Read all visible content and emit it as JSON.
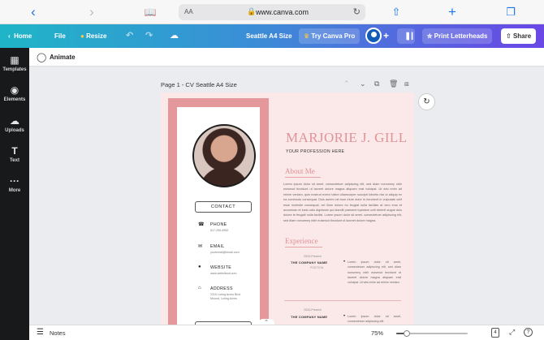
{
  "safari": {
    "back_icon": "chevron-left-icon",
    "forward_icon": "chevron-right-icon",
    "text_size_label": "AA",
    "url": "www.canva.com"
  },
  "topbar": {
    "home_label": "Home",
    "file_label": "File",
    "resize_label": "Resize",
    "doc_title": "Seattle A4 Size",
    "try_pro_label": "Try Canva Pro",
    "print_label": "Print Letterheads",
    "share_label": "Share",
    "colors": {
      "accent_start": "#1fb5c7",
      "accent_end": "#6a47e6"
    }
  },
  "sidebar": {
    "items": [
      {
        "label": "Templates",
        "icon": "templates-icon"
      },
      {
        "label": "Elements",
        "icon": "elements-icon"
      },
      {
        "label": "Uploads",
        "icon": "upload-cloud-icon"
      },
      {
        "label": "Text",
        "icon": "text-icon"
      },
      {
        "label": "More",
        "icon": "more-dots-icon"
      }
    ]
  },
  "toolbar": {
    "animate_label": "Animate"
  },
  "page": {
    "label": "Page 1 - CV Seattle A4 Size"
  },
  "resume": {
    "name": "MARJORIE J. GILL",
    "profession": "YOUR PROFESSION HERE",
    "contact_heading": "CONTACT",
    "phone_title": "PHONE",
    "phone_value": "617-290-4952",
    "email_title": "EMAIL",
    "email_value": "youremail@email.com",
    "website_title": "WEBSITE",
    "website_value": "www.websiteurl.com",
    "address_title": "ADDRESS",
    "address_value": "2310 Loring Acres Blvd Mound, Loring Acres",
    "social_heading": "SOCIAL MEDIA",
    "about_heading": "About Me",
    "about_text": "Lorem ipsum dolor sit amet, consectetuer adipiscing elit, sed diam nonummy nibh euismod tincidunt ut laoreet dolore magna aliquam erat volutpat. Ut wisi enim ad minim veniam, quis nostrud exerci tation ullamcorper suscipit lobortis nisl ut aliquip ex ea commodo consequat. Duis autem vel eum iriure dolor in hendrerit in vulputate velit esse molestie consequat, vel illum dolore eu feugiat nulla facilisis at vero eros et accumsan et iusto odio dignissim qui blandit praesent luptatum zzril delenit augue duis dolore te feugait nulla facilisi. Lorem ipsum dolor sit amet, consectetuer adipiscing elit, sed diam nonummy nibh euismod tincidunt ut laoreet dolore magna.",
    "experience_heading": "Experience",
    "experience": [
      {
        "date": "2020-Present",
        "company": "THE COMPANY NAME",
        "position": "POSITION",
        "text": "Lorem ipsum dolor sit amet, consectetuer adipiscing elit, sed diam nonummy nibh euismod tincidunt ut laoreet dolore magna aliquam erat volutpat. Ut wisi enim ad minim veniam."
      },
      {
        "date": "2020-Present",
        "company": "THE COMPANY NAME",
        "position": "POSITION",
        "text": "Lorem ipsum dolor sit amet, consectetuer adipiscing elit."
      }
    ]
  },
  "bottom": {
    "notes_label": "Notes",
    "zoom_label": "75%",
    "zoom_fraction": 0.15,
    "page_count": "4"
  }
}
